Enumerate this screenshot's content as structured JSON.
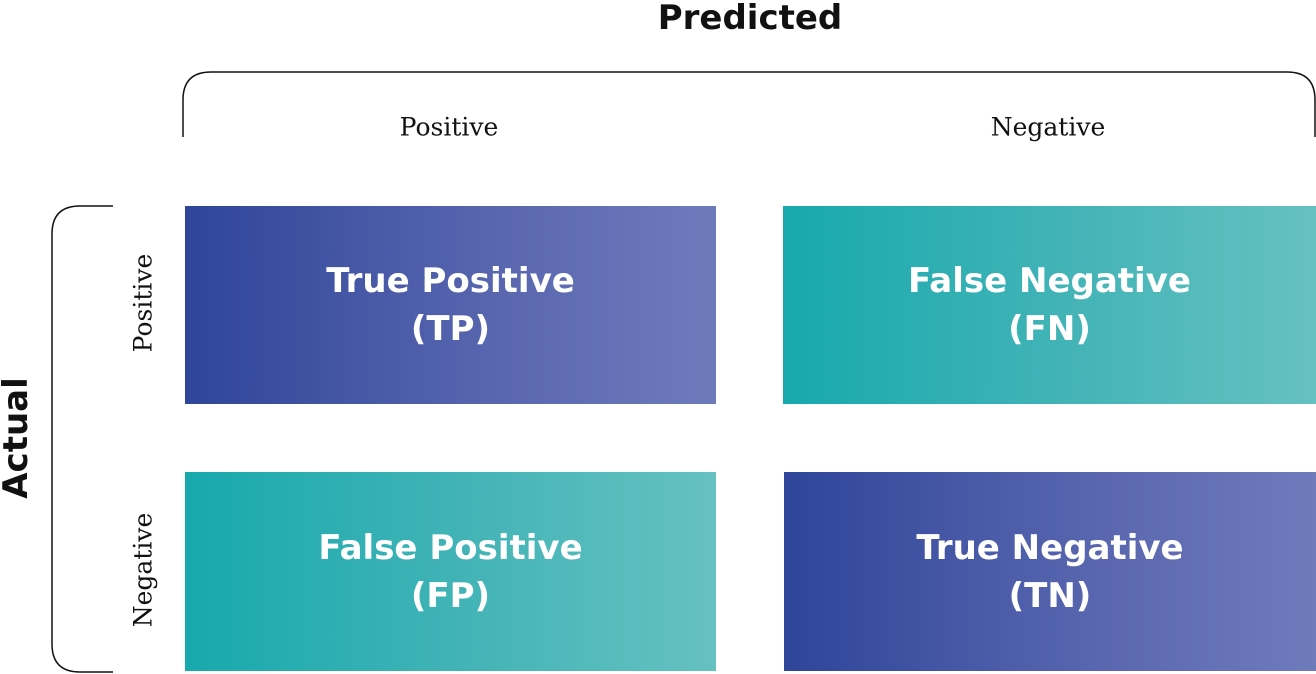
{
  "axes": {
    "predicted": "Predicted",
    "actual": "Actual"
  },
  "columns": [
    "Positive",
    "Negative"
  ],
  "rows": [
    "Positive",
    "Negative"
  ],
  "cells": [
    {
      "line1": "True Positive",
      "line2": "(TP)",
      "color": "#2e4599"
    },
    {
      "line1": "False Negative",
      "line2": "(FN)",
      "color": "#17a9ad"
    },
    {
      "line1": "False Positive",
      "line2": "(FP)",
      "color": "#17a9ad"
    },
    {
      "line1": "True Negative",
      "line2": "(TN)",
      "color": "#2e4599"
    }
  ]
}
